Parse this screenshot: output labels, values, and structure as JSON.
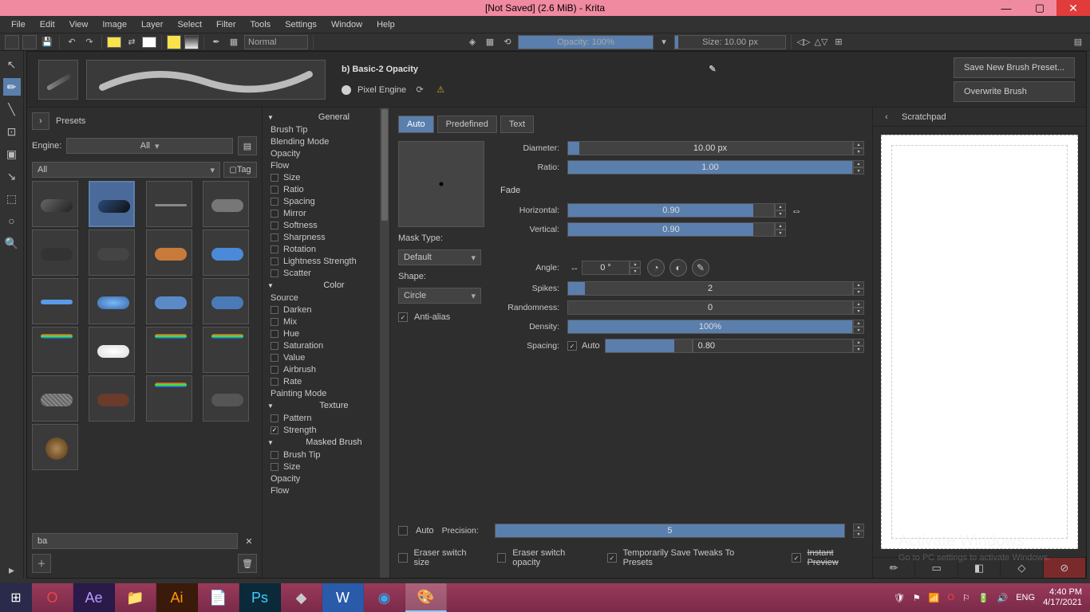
{
  "titlebar": {
    "title": "[Not Saved]  (2.6 MiB)  -  Krita"
  },
  "menu": [
    "File",
    "Edit",
    "View",
    "Image",
    "Layer",
    "Select",
    "Filter",
    "Tools",
    "Settings",
    "Window",
    "Help"
  ],
  "toolbar": {
    "blend_mode": "Normal",
    "opacity_label": "Opacity: 100%",
    "size_label": "Size: 10.00 px"
  },
  "brush": {
    "name": "b) Basic-2 Opacity",
    "engine": "Pixel Engine",
    "save_new": "Save New Brush Preset...",
    "overwrite": "Overwrite Brush"
  },
  "presets": {
    "header": "Presets",
    "engine_label": "Engine:",
    "engine_value": "All",
    "tag_value": "All",
    "tag_btn": "Tag",
    "search": "ba"
  },
  "param_sections": {
    "general": "General",
    "general_items": [
      "Brush Tip",
      "Blending Mode",
      "Opacity",
      "Flow"
    ],
    "general_checks": [
      "Size",
      "Ratio",
      "Spacing",
      "Mirror",
      "Softness",
      "Sharpness",
      "Rotation",
      "Lightness Strength",
      "Scatter"
    ],
    "color": "Color",
    "color_pre": "Source",
    "color_checks": [
      "Darken",
      "Mix",
      "Hue",
      "Saturation",
      "Value",
      "Airbrush",
      "Rate"
    ],
    "painting": "Painting Mode",
    "texture": "Texture",
    "texture_checks": [
      "Pattern",
      "Strength"
    ],
    "masked": "Masked Brush",
    "masked_checks": [
      "Brush Tip",
      "Size"
    ],
    "tail": [
      "Opacity",
      "Flow"
    ]
  },
  "controls": {
    "tabs": [
      "Auto",
      "Predefined",
      "Text"
    ],
    "mask_type": "Mask Type:",
    "mask_type_value": "Default",
    "shape": "Shape:",
    "shape_value": "Circle",
    "antialias": "Anti-alias",
    "diameter": "Diameter:",
    "diameter_val": "10.00 px",
    "ratio": "Ratio:",
    "ratio_val": "1.00",
    "fade": "Fade",
    "horizontal": "Horizontal:",
    "h_val": "0.90",
    "vertical": "Vertical:",
    "v_val": "0.90",
    "angle": "Angle:",
    "angle_val": "0 °",
    "spikes": "Spikes:",
    "spikes_val": "2",
    "randomness": "Randomness:",
    "rand_val": "0",
    "density": "Density:",
    "density_val": "100%",
    "spacing": "Spacing:",
    "spacing_auto": "Auto",
    "spacing_val": "0.80",
    "precision_auto": "Auto",
    "precision": "Precision:",
    "precision_val": "5"
  },
  "bottom": {
    "eraser_size": "Eraser switch size",
    "eraser_opacity": "Eraser switch opacity",
    "temp_save": "Temporarily Save Tweaks To Presets",
    "instant": "Instant Preview"
  },
  "scratchpad": {
    "title": "Scratchpad"
  },
  "watermark": {
    "title": "Activate Windows",
    "sub": "Go to PC settings to activate Windows."
  },
  "tray": {
    "lang": "ENG",
    "time": "4:40 PM",
    "date": "4/17/2021"
  }
}
